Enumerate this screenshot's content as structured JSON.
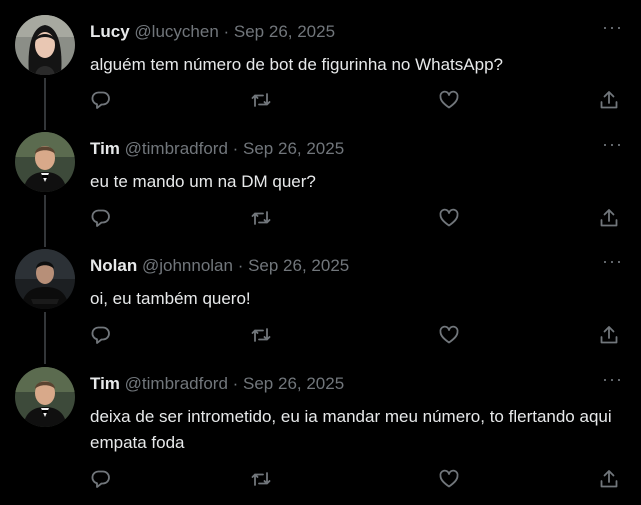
{
  "tweets": [
    {
      "name": "Lucy",
      "handle": "@lucychen",
      "date": "Sep 26, 2025",
      "text": "alguém tem número de bot de figurinha no WhatsApp?"
    },
    {
      "name": "Tim",
      "handle": "@timbradford",
      "date": "Sep 26, 2025",
      "text": "eu te mando um na DM quer?"
    },
    {
      "name": "Nolan",
      "handle": "@johnnolan",
      "date": "Sep 26, 2025",
      "text": "oi, eu também quero!"
    },
    {
      "name": "Tim",
      "handle": "@timbradford",
      "date": "Sep 26, 2025",
      "text": "deixa de ser intrometido, eu ia mandar meu número, to flertando aqui empata foda"
    }
  ],
  "separator": " · ",
  "more_label": "···",
  "icons": {
    "reply": "reply-icon",
    "retweet": "retweet-icon",
    "like": "like-icon",
    "share": "share-icon",
    "more": "more-icon"
  },
  "colors": {
    "background": "#000000",
    "text": "#e7e9ea",
    "secondary": "#71767b",
    "thread_line": "#333639"
  }
}
